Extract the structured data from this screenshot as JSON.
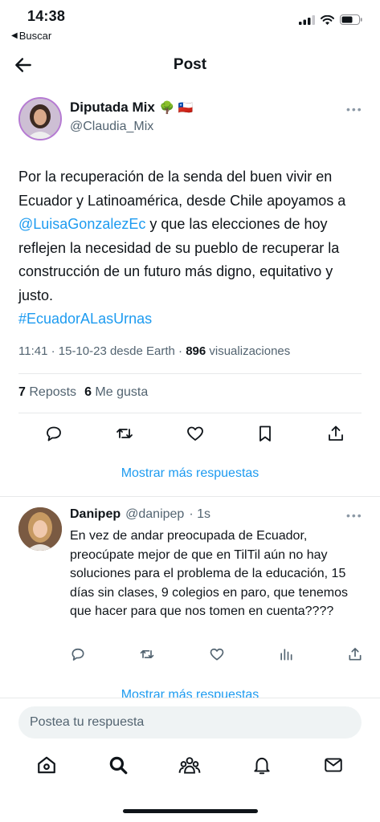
{
  "status_bar": {
    "time": "14:38",
    "back_label": "Buscar",
    "icons": [
      "cellular-signal-icon",
      "wifi-icon",
      "battery-icon"
    ]
  },
  "header": {
    "title": "Post",
    "back_icon": "back-arrow-icon"
  },
  "post": {
    "author_name": "Diputada Mix",
    "author_emojis": "🌳 🇨🇱",
    "author_handle": "@Claudia_Mix",
    "text_before_mention": "Por la recuperación de la senda del buen vivir en Ecuador y Latinoamérica, desde Chile apoyamos a ",
    "mention": "@LuisaGonzalezEc",
    "text_after_mention": " y que las elecciones de hoy reflejen la necesidad de su pueblo de recuperar la construcción de un futuro más digno, equitativo y justo.",
    "hashtag": "#EcuadorALasUrnas",
    "timestamp": "11:41 · 15-10-23 desde Earth · ",
    "views_count": "896",
    "views_label": " visualizaciones",
    "reposts_count": "7",
    "reposts_label": "Reposts",
    "likes_count": "6",
    "likes_label": "Me gusta"
  },
  "show_more_label": "Mostrar más respuestas",
  "reply": {
    "author_name": "Danipep",
    "author_handle": "@danipep",
    "time": "· 1s",
    "text": "En vez de andar preocupada de Ecuador, preocúpate mejor de que en TilTil aún no hay soluciones para el problema de la educación, 15 días sin clases, 9 colegios en paro, que tenemos que hacer para que nos tomen en cuenta????"
  },
  "composer": {
    "placeholder": "Postea tu respuesta"
  },
  "tabbar": {
    "items": [
      "home-icon",
      "search-icon",
      "communities-icon",
      "notifications-icon",
      "messages-icon"
    ]
  },
  "colors": {
    "accent": "#1d9bf0",
    "text_primary": "#0f1419",
    "text_secondary": "#536471",
    "divider": "#e7e9ea"
  }
}
